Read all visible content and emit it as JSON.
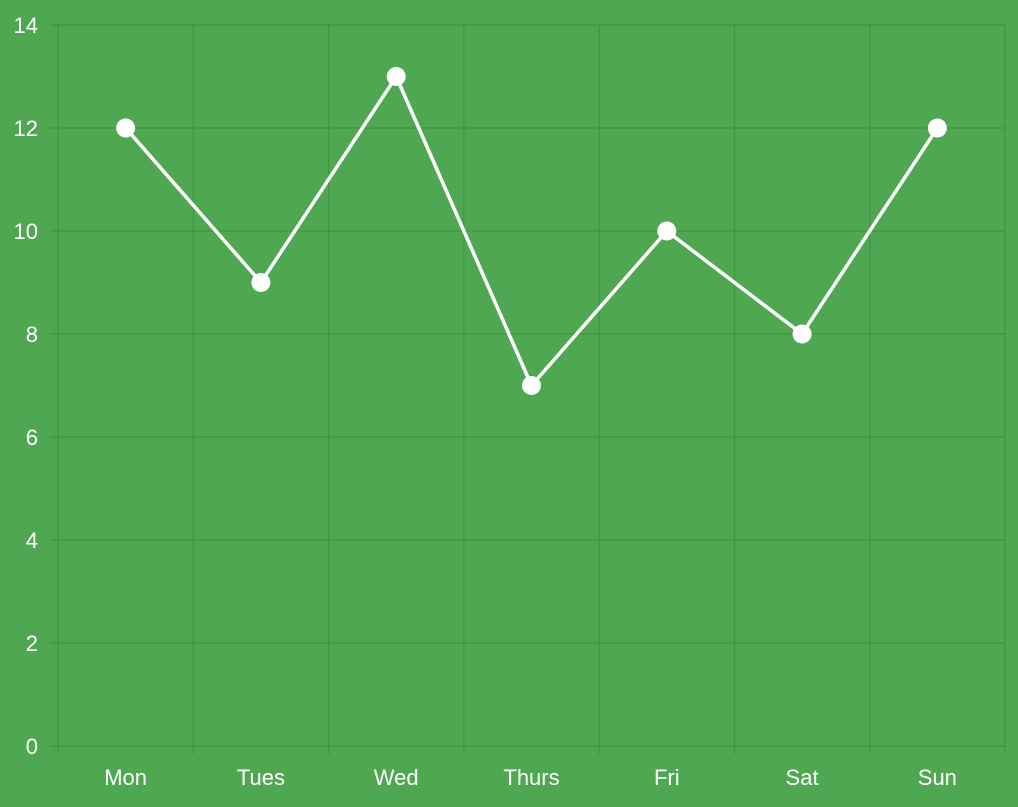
{
  "chart_data": {
    "type": "line",
    "title": "",
    "xlabel": "",
    "ylabel": "",
    "categories": [
      "Mon",
      "Tues",
      "Wed",
      "Thurs",
      "Fri",
      "Sat",
      "Sun"
    ],
    "series": [
      {
        "name": "",
        "values": [
          12,
          9,
          13,
          7,
          10,
          8,
          12
        ]
      }
    ],
    "ylim": [
      0,
      14
    ],
    "yticks": [
      "0",
      "2",
      "4",
      "6",
      "8",
      "10",
      "12",
      "14"
    ],
    "grid": true,
    "legend": "none",
    "colors": {
      "background": "#4fa851",
      "grid": "#3f9641",
      "line": "#ffffff",
      "point": "#ffffff",
      "text": "#ffffff"
    }
  }
}
